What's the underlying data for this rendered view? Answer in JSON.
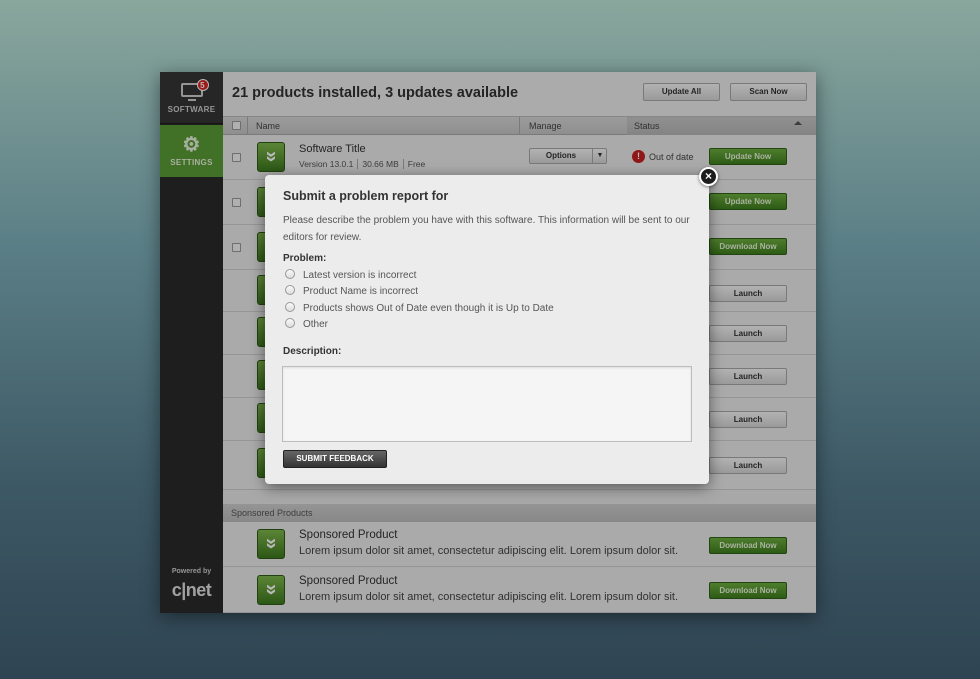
{
  "sidebar": {
    "software_label": "SOFTWARE",
    "software_badge": "5",
    "settings_label": "SETTINGS",
    "powered_by": "Powered by",
    "brand": "c|net"
  },
  "header": {
    "title": "21 products installed, 3 updates available",
    "update_all": "Update All",
    "scan_now": "Scan Now"
  },
  "columns": {
    "name": "Name",
    "manage": "Manage",
    "status": "Status"
  },
  "rows": [
    {
      "title": "Software Title",
      "version": "Version 13.0.1",
      "size": "30.66 MB",
      "price": "Free",
      "options": "Options",
      "status": "Out of date",
      "action": "Update Now"
    },
    {
      "action": "Update Now"
    },
    {
      "action": "Download Now"
    },
    {
      "action": "Launch"
    },
    {
      "action": "Launch"
    },
    {
      "action": "Launch"
    },
    {
      "action": "Launch"
    },
    {
      "action": "Launch"
    }
  ],
  "sponsored": {
    "header": "Sponsored Products",
    "items": [
      {
        "title": "Sponsored Product",
        "desc": "Lorem ipsum dolor sit amet, consectetur adipiscing elit. Lorem ipsum dolor sit.",
        "action": "Download Now"
      },
      {
        "title": "Sponsored Product",
        "desc": "Lorem ipsum dolor sit amet, consectetur adipiscing elit. Lorem ipsum dolor sit.",
        "action": "Download Now"
      }
    ]
  },
  "modal": {
    "title": "Submit a problem report for",
    "description": "Please describe the problem you have with this software. This information will be sent to our editors for review.",
    "problem_label": "Problem:",
    "options": [
      "Latest version is incorrect",
      "Product Name is incorrect",
      "Products shows Out of Date even though it is Up to Date",
      "Other"
    ],
    "description_label": "Description:",
    "submit": "SUBMIT FEEDBACK",
    "close_glyph": "×"
  },
  "colors": {
    "accent_green": "#5b9b37",
    "alert_red": "#c62020"
  }
}
